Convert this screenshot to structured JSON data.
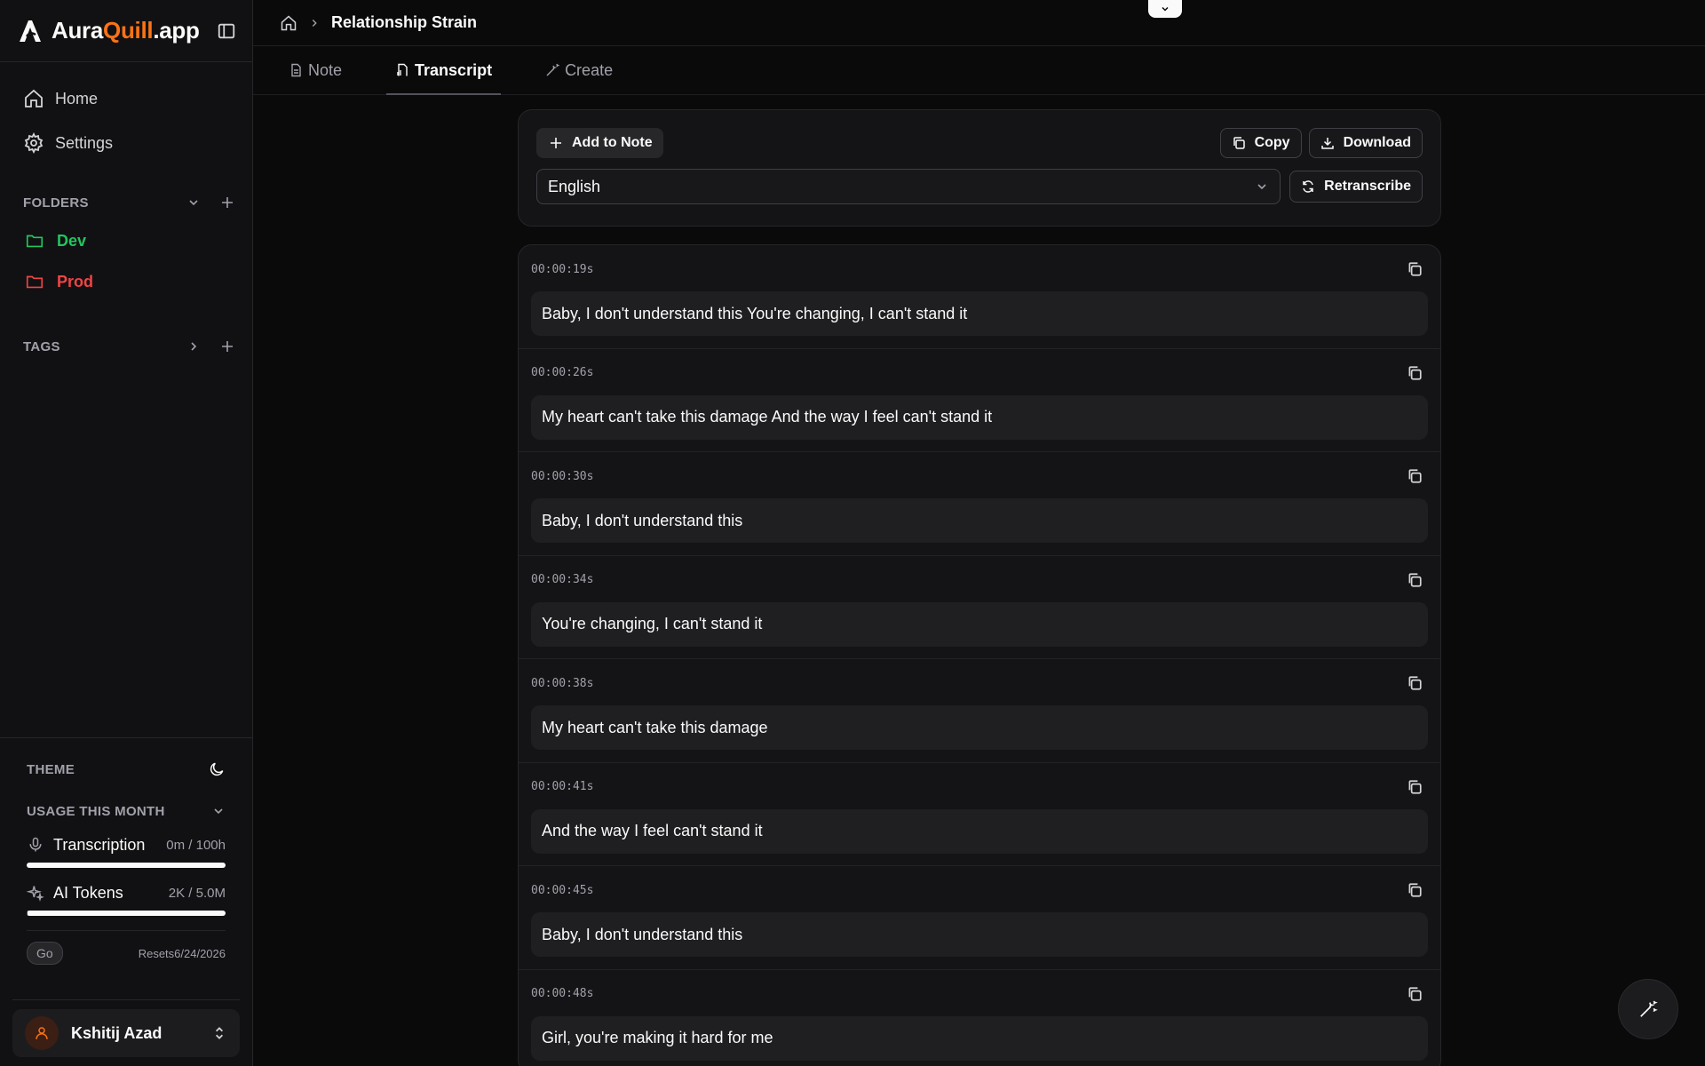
{
  "brand": {
    "name_part1": "Aura",
    "name_part2": "Quill",
    "name_part3": ".app"
  },
  "nav": {
    "home": "Home",
    "settings": "Settings"
  },
  "folders": {
    "title": "FOLDERS",
    "items": [
      {
        "label": "Dev",
        "color": "#22c55e"
      },
      {
        "label": "Prod",
        "color": "#ef4444"
      }
    ]
  },
  "tags": {
    "title": "TAGS"
  },
  "theme": {
    "label": "THEME"
  },
  "usage": {
    "title": "USAGE THIS MONTH",
    "transcription": {
      "label": "Transcription",
      "value": "0m / 100h",
      "used_fraction": 0.0
    },
    "ai_tokens": {
      "label": "AI Tokens",
      "value": "2K / 5.0M",
      "used_fraction": 0.0004
    },
    "plan": "Go",
    "resets": "Resets6/24/2026"
  },
  "user": {
    "name": "Kshitij Azad"
  },
  "breadcrumb": {
    "current": "Relationship Strain"
  },
  "tabs": {
    "note": "Note",
    "transcript": "Transcript",
    "create": "Create"
  },
  "toolbar": {
    "add_to_note": "Add to Note",
    "copy": "Copy",
    "download": "Download",
    "language": "English",
    "retranscribe": "Retranscribe"
  },
  "segments": [
    {
      "time": "00:00:19s",
      "text": "Baby, I don't understand this You're changing, I can't stand it"
    },
    {
      "time": "00:00:26s",
      "text": "My heart can't take this damage And the way I feel can't stand it"
    },
    {
      "time": "00:00:30s",
      "text": "Baby, I don't understand this"
    },
    {
      "time": "00:00:34s",
      "text": "You're changing, I can't stand it"
    },
    {
      "time": "00:00:38s",
      "text": "My heart can't take this damage"
    },
    {
      "time": "00:00:41s",
      "text": "And the way I feel can't stand it"
    },
    {
      "time": "00:00:45s",
      "text": "Baby, I don't understand this"
    },
    {
      "time": "00:00:48s",
      "text": "Girl, you're making it hard for me"
    }
  ],
  "colors": {
    "accent": "#f97316",
    "background": "#0a0a0b",
    "sidebar": "#111113"
  }
}
